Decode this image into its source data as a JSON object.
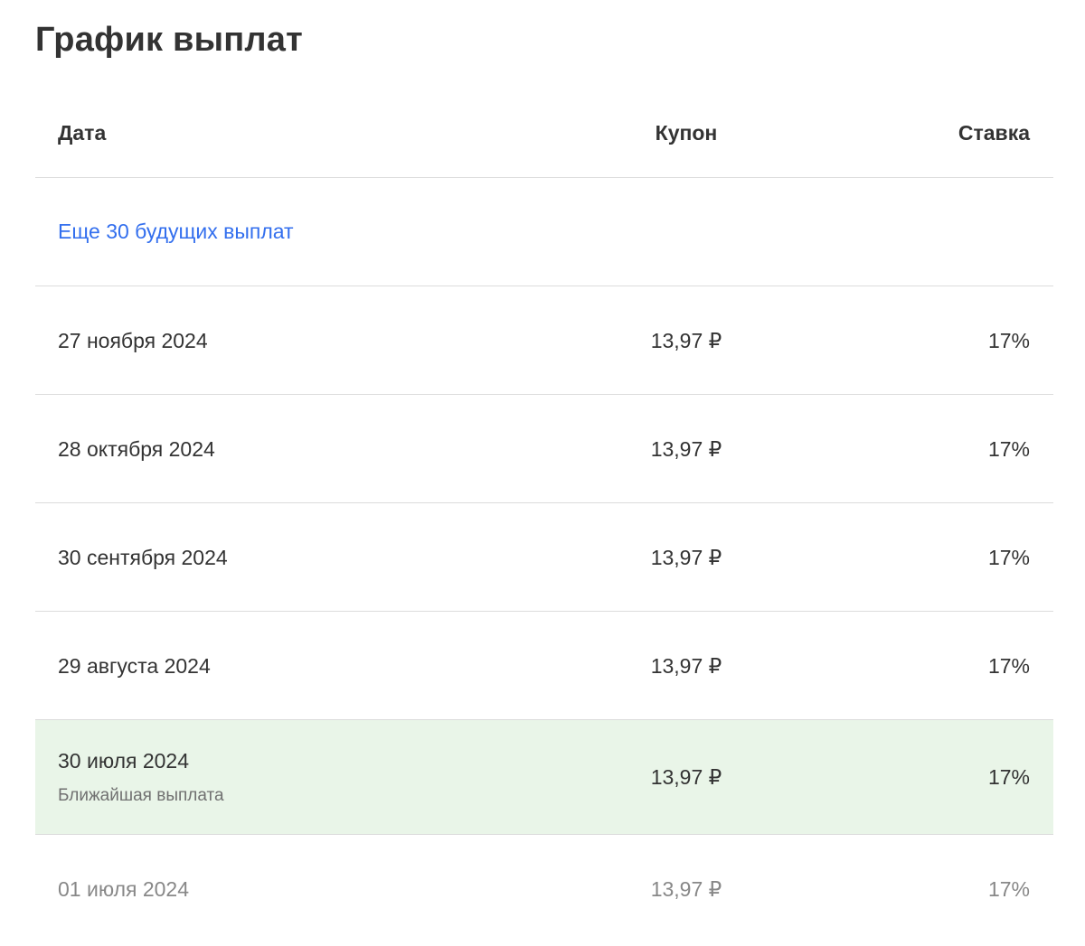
{
  "page": {
    "title": "График выплат"
  },
  "table": {
    "headers": {
      "date": "Дата",
      "coupon": "Купон",
      "rate": "Ставка"
    },
    "more_link": "Еще 30 будущих выплат",
    "rows": [
      {
        "date": "27 ноября 2024",
        "coupon": "13,97 ₽",
        "rate": "17%"
      },
      {
        "date": "28 октября 2024",
        "coupon": "13,97 ₽",
        "rate": "17%"
      },
      {
        "date": "30 сентября 2024",
        "coupon": "13,97 ₽",
        "rate": "17%"
      },
      {
        "date": "29 августа 2024",
        "coupon": "13,97 ₽",
        "rate": "17%"
      },
      {
        "date": "30 июля 2024",
        "label": "Ближайшая выплата",
        "coupon": "13,97 ₽",
        "rate": "17%"
      },
      {
        "date": "01 июля 2024",
        "coupon": "13,97 ₽",
        "rate": "17%"
      }
    ]
  },
  "colors": {
    "text": "#333333",
    "link": "#336fee",
    "highlight_bg": "#e9f5e8",
    "muted": "#888888",
    "divider": "#dcdcdc"
  }
}
